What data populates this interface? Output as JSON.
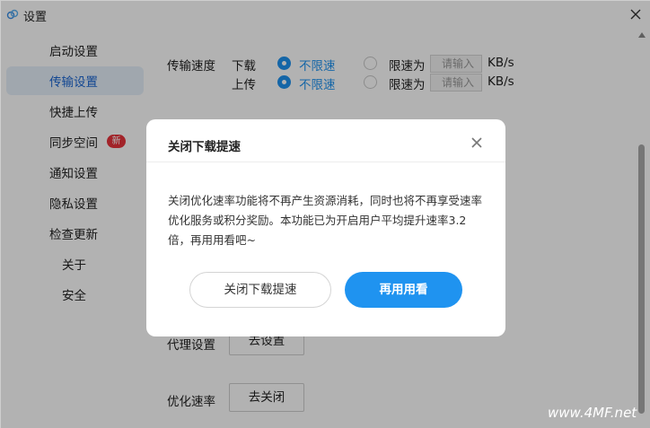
{
  "window": {
    "title": "设置"
  },
  "sidebar": {
    "items": [
      {
        "label": "启动设置"
      },
      {
        "label": "传输设置",
        "active": true
      },
      {
        "label": "快捷上传"
      },
      {
        "label": "同步空间",
        "badge": "新"
      },
      {
        "label": "通知设置"
      },
      {
        "label": "隐私设置"
      },
      {
        "label": "检查更新"
      },
      {
        "label": "关于"
      },
      {
        "label": "安全"
      }
    ]
  },
  "transfer": {
    "speed_label": "传输速度",
    "download": {
      "label": "下载",
      "unlimited": "不限速",
      "limit": "限速为",
      "placeholder": "请输入",
      "unit": "KB/s"
    },
    "upload": {
      "label": "上传",
      "unlimited": "不限速",
      "limit": "限速为",
      "placeholder": "请输入",
      "unit": "KB/s"
    }
  },
  "proxy": {
    "label": "代理设置",
    "button": "去设置"
  },
  "optimize": {
    "label": "优化速率",
    "button": "去关闭"
  },
  "dialog": {
    "title": "关闭下载提速",
    "body": "关闭优化速率功能将不再产生资源消耗，同时也将不再享受速率优化服务或积分奖励。本功能已为开启用户平均提升速率3.2倍，再用用看吧~",
    "secondary_button": "关闭下载提速",
    "primary_button": "再用用看"
  },
  "watermark": "www.4MF.net",
  "colors": {
    "accent": "#1f93f0",
    "badge": "#e8333b",
    "active_bg": "#e6effa"
  }
}
